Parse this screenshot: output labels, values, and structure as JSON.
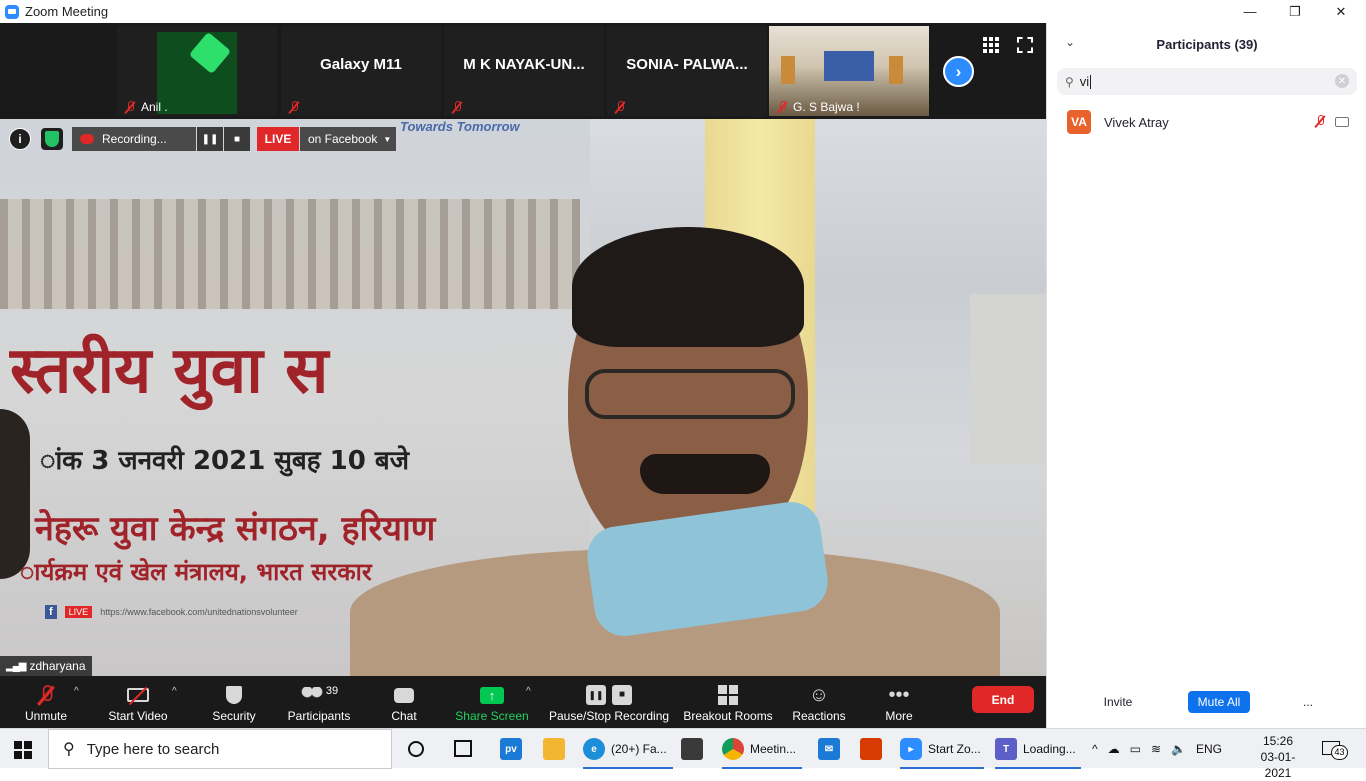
{
  "window": {
    "title": "Zoom Meeting",
    "minimize": "—",
    "restore": "❐",
    "close": "✕"
  },
  "strip": {
    "tiles": [
      {
        "name": "",
        "footer": "Anil ."
      },
      {
        "name": "Galaxy M11",
        "footer": ""
      },
      {
        "name": "M K NAYAK-UN...",
        "footer": ""
      },
      {
        "name": "SONIA-  PALWA...",
        "footer": ""
      },
      {
        "name": "",
        "footer": "G. S Bajwa !"
      }
    ],
    "next": "›"
  },
  "video_overlay": {
    "recording_label": "Recording...",
    "live_label": "LIVE",
    "stream_target": "on Facebook",
    "speaker_name": "zdharyana",
    "banner_top_text": "Towards Tomorrow",
    "banner_line1": "स्तरीय युवा स",
    "banner_line2": "ांक 3 जनवरी 2021 सुबह 10 बजे",
    "banner_line3": "नेहरू युवा केन्द्र संगठन, हरियाण",
    "banner_line4": "ार्यक्रम एवं खेल मंत्रालय, भारत सरकार",
    "banner_url": "https://www.facebook.com/unitednationsvolunteer",
    "banner_live_tag": "LIVE"
  },
  "toolbar": {
    "unmute": "Unmute",
    "start_video": "Start Video",
    "security": "Security",
    "participants": "Participants",
    "participants_count": "39",
    "chat": "Chat",
    "share_screen": "Share Screen",
    "pause_stop_recording": "Pause/Stop Recording",
    "breakout_rooms": "Breakout Rooms",
    "reactions": "Reactions",
    "more": "More",
    "end": "End"
  },
  "panel": {
    "title": "Participants (39)",
    "search_value": "vi",
    "participants": [
      {
        "initials": "VA",
        "name": "Vivek Atray"
      }
    ],
    "invite": "Invite",
    "mute_all": "Mute All",
    "more": "..."
  },
  "taskbar": {
    "search_placeholder": "Type here to search",
    "apps": [
      {
        "label": "(20+) Fa..."
      },
      {
        "label": "Meetin..."
      },
      {
        "label": "Start Zo..."
      },
      {
        "label": "Loading..."
      }
    ],
    "lang": "ENG",
    "time": "15:26",
    "date": "03-01-2021",
    "notifications": "43"
  },
  "colors": {
    "zoom_blue": "#2D8CFF",
    "end_red": "#E02828",
    "share_green": "#00C853",
    "avatar_orange": "#E8632C"
  }
}
